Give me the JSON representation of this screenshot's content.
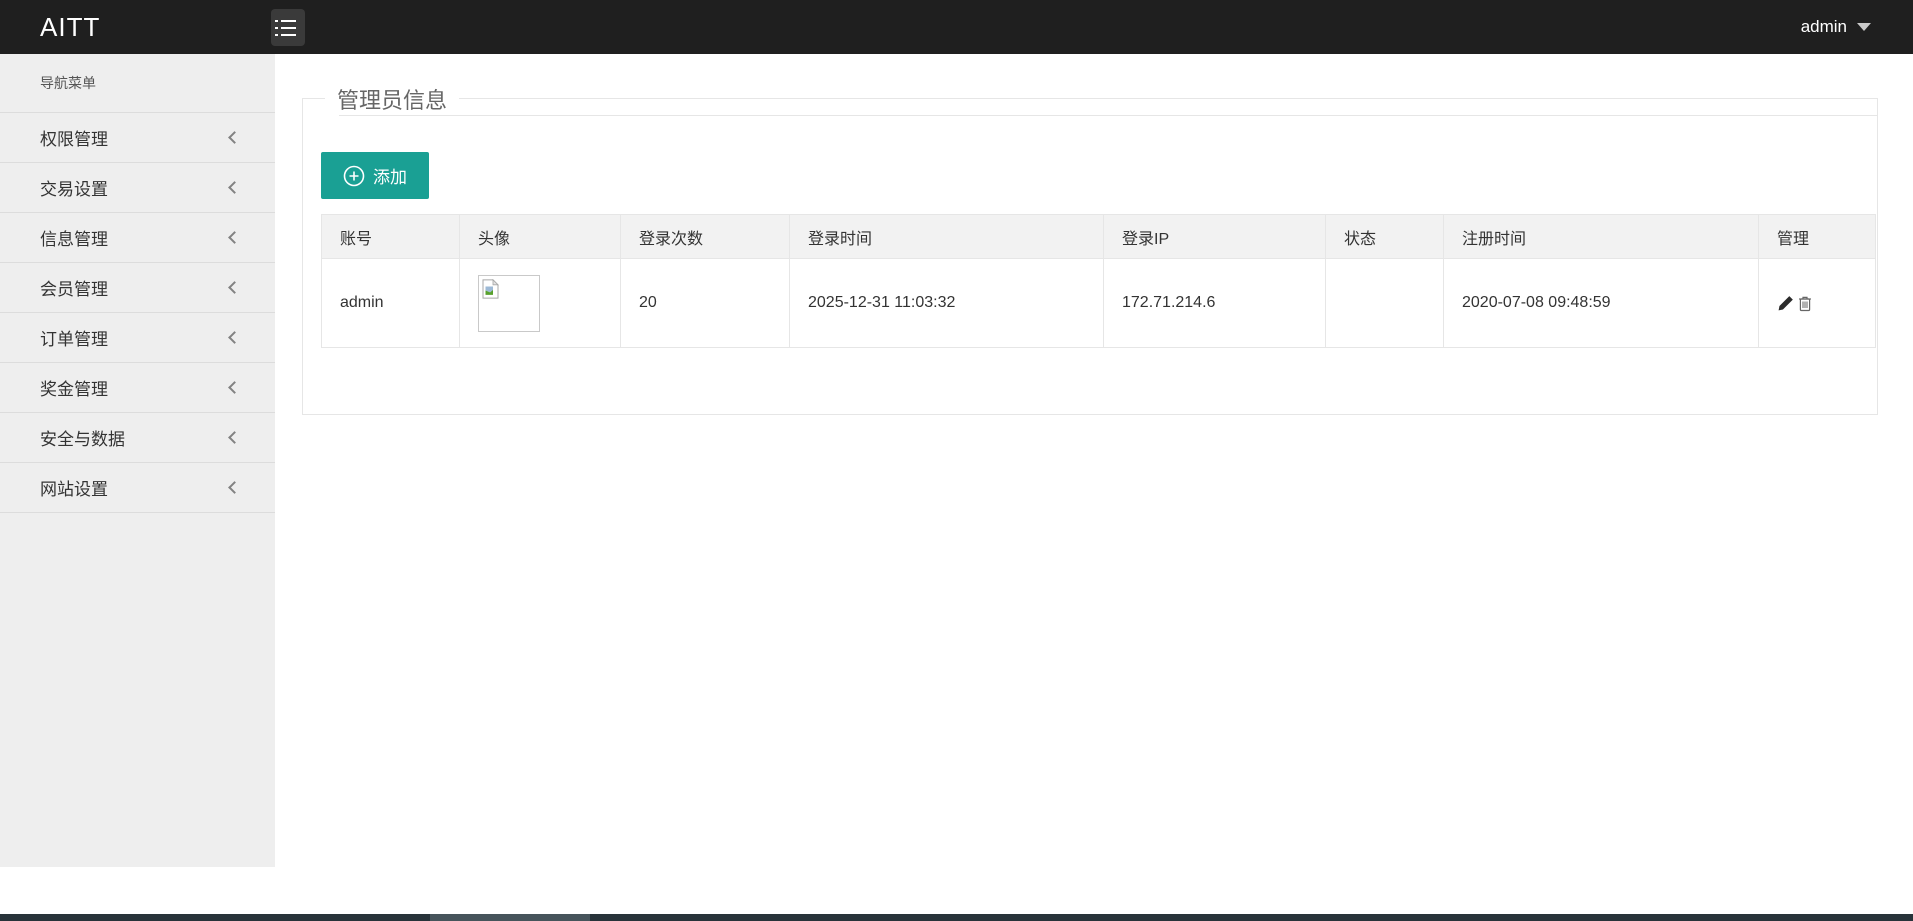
{
  "topbar": {
    "logo": "AITT",
    "user": "admin"
  },
  "sidebar": {
    "title": "导航菜单",
    "items": [
      {
        "label": "权限管理"
      },
      {
        "label": "交易设置"
      },
      {
        "label": "信息管理"
      },
      {
        "label": "会员管理"
      },
      {
        "label": "订单管理"
      },
      {
        "label": "奖金管理"
      },
      {
        "label": "安全与数据"
      },
      {
        "label": "网站设置"
      }
    ]
  },
  "page": {
    "title": "管理员信息"
  },
  "toolbar": {
    "add_label": "添加"
  },
  "table": {
    "columns": [
      "账号",
      "头像",
      "登录次数",
      "登录时间",
      "登录IP",
      "状态",
      "注册时间",
      "管理"
    ],
    "rows": [
      {
        "account": "admin",
        "login_count": "20",
        "login_time": "2025-12-31 11:03:32",
        "login_ip": "172.71.214.6",
        "status": "",
        "register_time": "2020-07-08 09:48:59"
      }
    ]
  },
  "icons": {
    "add": "plus-circle-icon",
    "edit": "pencil-icon",
    "delete": "trash-icon",
    "avatar_placeholder": "broken-image-icon"
  },
  "colors": {
    "accent": "#1aa094",
    "topbar_bg": "#1f1f1f",
    "sidebar_bg": "#eeeeee",
    "table_border": "#e6e6e6",
    "table_header_bg": "#f2f2f2",
    "scrollbar_bg": "#28333a"
  }
}
